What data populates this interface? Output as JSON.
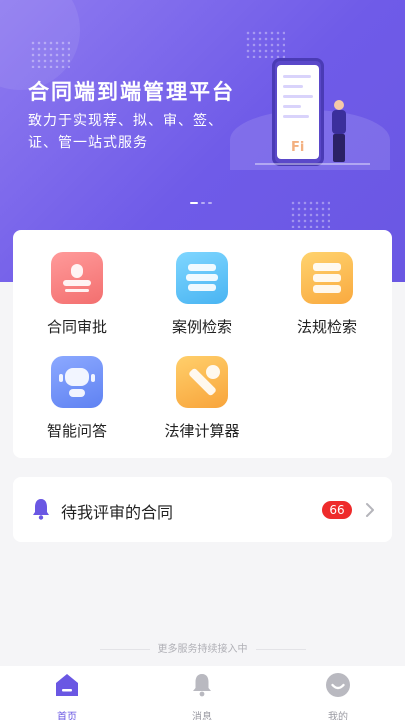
{
  "banner": {
    "title": "合同端到端管理平台",
    "subtitle": "致力于实现荐、拟、审、签、证、管一站式服务",
    "phone_logo": "Fi",
    "slides": 3,
    "active_slide": 1
  },
  "functions": [
    {
      "label": "合同审批",
      "icon": "stamp-icon",
      "color": "#f36f6f"
    },
    {
      "label": "案例检索",
      "icon": "books-icon",
      "color": "#49b4f2"
    },
    {
      "label": "法规检索",
      "icon": "server-icon",
      "color": "#f9a93f"
    },
    {
      "label": "智能问答",
      "icon": "robot-icon",
      "color": "#5f82f2"
    },
    {
      "label": "法律计算器",
      "icon": "wrench-icon",
      "color": "#f8a43b"
    }
  ],
  "todo": {
    "label": "待我评审的合同",
    "count": "66",
    "icon": "bell-icon",
    "accent": "#6a57e3",
    "badge_color": "#ee2b2b"
  },
  "footer_note": "更多服务持续接入中",
  "tabbar": {
    "items": [
      {
        "label": "首页",
        "icon": "home-icon",
        "active": true
      },
      {
        "label": "消息",
        "icon": "bell-icon",
        "active": false
      },
      {
        "label": "我的",
        "icon": "smile-icon",
        "active": false
      }
    ],
    "active_color": "#6a57e3",
    "inactive_color": "#9a9aa2"
  }
}
